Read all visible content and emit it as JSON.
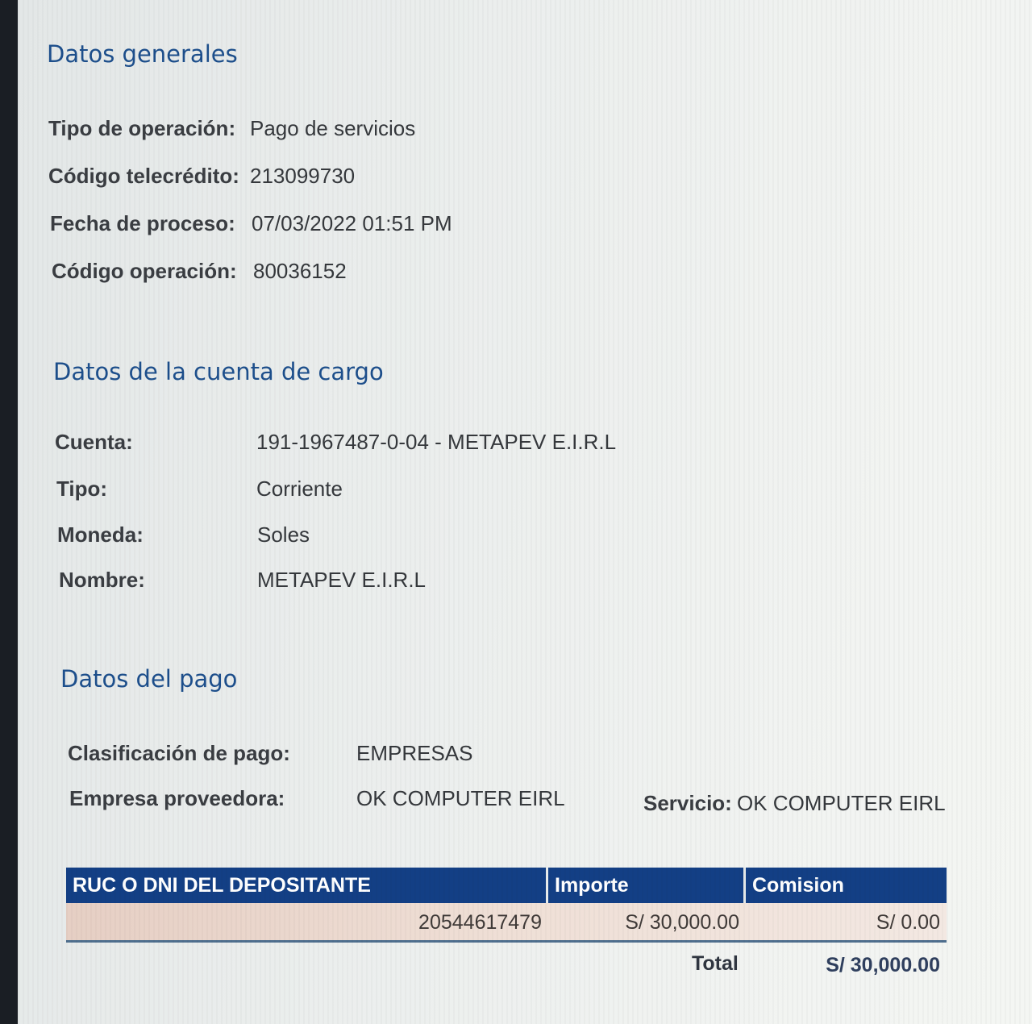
{
  "general": {
    "title": "Datos generales",
    "fields": [
      {
        "label": "Tipo de operación:",
        "value": "Pago de servicios"
      },
      {
        "label": "Código telecrédito:",
        "value": "213099730"
      },
      {
        "label": "Fecha de proceso:",
        "value": "07/03/2022 01:51 PM"
      },
      {
        "label": "Código operación:",
        "value": "80036152"
      }
    ]
  },
  "cuenta": {
    "title": "Datos de la cuenta de cargo",
    "fields": [
      {
        "label": "Cuenta:",
        "value": "191-1967487-0-04 - METAPEV E.I.R.L"
      },
      {
        "label": "Tipo:",
        "value": "Corriente"
      },
      {
        "label": "Moneda:",
        "value": "Soles"
      },
      {
        "label": "Nombre:",
        "value": "METAPEV E.I.R.L"
      }
    ]
  },
  "pago": {
    "title": "Datos del pago",
    "clasificacion": {
      "label": "Clasificación de pago:",
      "value": "EMPRESAS"
    },
    "empresa": {
      "label": "Empresa proveedora:",
      "value": "OK COMPUTER EIRL"
    },
    "servicio": {
      "label": "Servicio:",
      "value": "OK COMPUTER EIRL"
    }
  },
  "table": {
    "headers": [
      "RUC O DNI DEL DEPOSITANTE",
      "Importe",
      "Comision"
    ],
    "rows": [
      [
        "20544617479",
        "S/ 30,000.00",
        "S/ 0.00"
      ]
    ],
    "total_label": "Total",
    "total_value": "S/ 30,000.00"
  }
}
